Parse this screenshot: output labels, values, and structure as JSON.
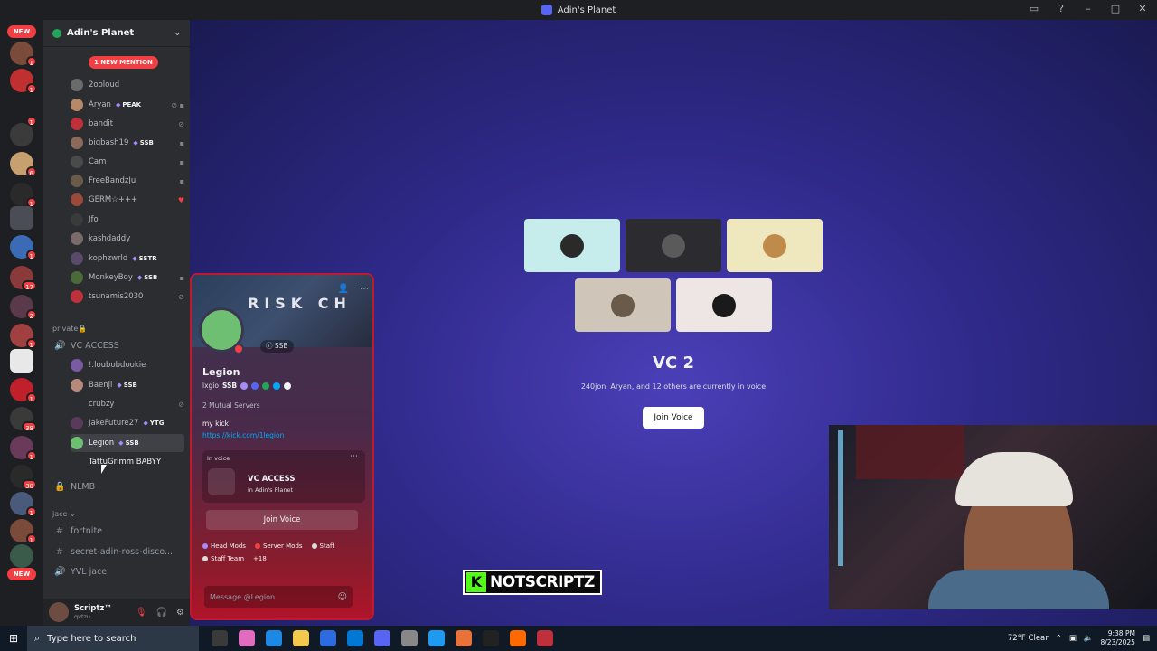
{
  "window": {
    "title": "Adin's Planet"
  },
  "guild_bar": {
    "new_top": "NEW",
    "new_bottom": "NEW",
    "badges": [
      "1",
      "1",
      "1",
      "6",
      "1",
      "1",
      "17",
      "2",
      "1",
      "1",
      "38",
      "1",
      "30",
      "1",
      "1",
      "15",
      "1",
      "1"
    ]
  },
  "server": {
    "name": "Adin's Planet"
  },
  "members_top": {
    "mention_pill": "1 NEW MENTION",
    "list": [
      {
        "name": "2ooloud",
        "tag": ""
      },
      {
        "name": "Aryan",
        "tag": "PEAK"
      },
      {
        "name": "bandit",
        "tag": ""
      },
      {
        "name": "bigbash19",
        "tag": "SSB"
      },
      {
        "name": "Cam",
        "tag": ""
      },
      {
        "name": "FreeBandzJu",
        "tag": ""
      },
      {
        "name": "GERM☆+++",
        "tag": ""
      },
      {
        "name": "Jfo",
        "tag": ""
      },
      {
        "name": "kashdaddy",
        "tag": ""
      },
      {
        "name": "kophzwrld",
        "tag": "SSTR"
      },
      {
        "name": "MonkeyBoy",
        "tag": "SSB"
      },
      {
        "name": "tsunamis2030",
        "tag": ""
      }
    ]
  },
  "categories": {
    "private": "private🔒",
    "jace": "jace"
  },
  "voice_channel": {
    "name": "VC ACCESS"
  },
  "vc_members": [
    {
      "name": "!.loubobdookie",
      "tag": ""
    },
    {
      "name": "Baenji",
      "tag": "SSB"
    },
    {
      "name": "crubzy",
      "tag": ""
    },
    {
      "name": "JakeFuture27",
      "tag": "YTG"
    },
    {
      "name": "Legion",
      "tag": "SSB"
    },
    {
      "name": "TattuGrimm BABYY",
      "tag": ""
    }
  ],
  "channels": {
    "nlmb": "NLMB",
    "fortnite": "fortnite",
    "secret": "secret-adin-ross-disco...",
    "yvl": "YVL jace"
  },
  "user": {
    "name": "Scriptz™",
    "status": "qvtzu"
  },
  "profile": {
    "banner_text": "RISK CH",
    "server_tag": "SSB",
    "name": "Legion",
    "username": "lxgio",
    "username_tag": "SSB",
    "mutual": "2 Mutual Servers",
    "bio": "my kick",
    "link": "https://kick.com/1legion",
    "in_voice_label": "In voice",
    "vc_name": "VC ACCESS",
    "vc_server": "in Adin's Planet",
    "join_label": "Join Voice",
    "roles": [
      {
        "name": "Head Mods",
        "color": "#a78bfa"
      },
      {
        "name": "Server Mods",
        "color": "#f23f43"
      },
      {
        "name": "Staff",
        "color": "#dbdee1"
      },
      {
        "name": "Staff Team",
        "color": "#dbdee1"
      }
    ],
    "roles_more": "+18",
    "message_placeholder": "Message @Legion"
  },
  "stage": {
    "title": "VC 2",
    "subtitle": "240jon, Aryan, and 12 others are currently in voice",
    "join_label": "Join Voice",
    "tiles": [
      {
        "bg": "#c7ecec"
      },
      {
        "bg": "#2c2b2f"
      },
      {
        "bg": "#efe7bd"
      },
      {
        "bg": "#cfc5b8"
      },
      {
        "bg": "#eee5e5"
      }
    ]
  },
  "overlay": {
    "streamer": "NOTSCRIPTZ",
    "logo_letter": "K"
  },
  "taskbar": {
    "search_placeholder": "Type here to search",
    "weather": "72°F  Clear",
    "time": "9:38 PM",
    "date": "8/23/2025"
  },
  "colors": {
    "accent": "#5865f2",
    "danger": "#f23f43",
    "online": "#23a559",
    "kick": "#53fc18"
  }
}
